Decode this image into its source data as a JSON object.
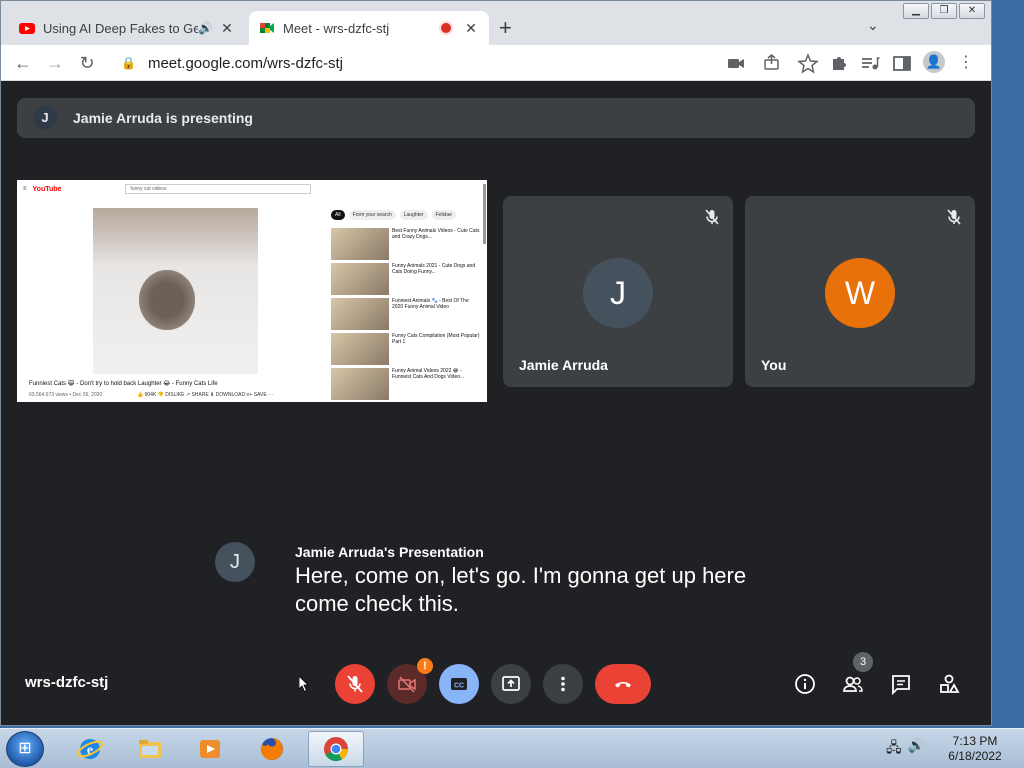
{
  "browser": {
    "tabs": [
      {
        "title": "Using AI Deep Fakes to Get R",
        "state": "inactive",
        "favicon": "youtube-icon"
      },
      {
        "title": "Meet - wrs-dzfc-stj",
        "state": "active",
        "favicon": "google-meet-icon"
      }
    ],
    "url": "meet.google.com/wrs-dzfc-stj"
  },
  "meet": {
    "presenting_banner": {
      "avatar_letter": "J",
      "text": "Jamie Arruda is presenting"
    },
    "presentation": {
      "yt_logo": "YouTube",
      "search": "funny cat videos",
      "chips": [
        "All",
        "From your search",
        "Laughter",
        "Felidae"
      ],
      "video_title": "Funniest Cats 😹 - Don't try to hold back Laughter 😂 - Funny Cats Life",
      "video_meta": "63,564,673 views • Dec 26, 2020",
      "video_actions": "👍 904K   👎 DISLIKE   ↗ SHARE   ⬇ DOWNLOAD   ≡+ SAVE   ···",
      "related": [
        {
          "title": "Best Funny Animals Videos - Cute Cats and Crazy Dogs..."
        },
        {
          "title": "Funny Animals 2021 - Cute Dogs and Cats Doing Funny..."
        },
        {
          "title": "Funniest Animals 🐾 - Best Of The 2020 Funny Animal Video"
        },
        {
          "title": "Funny Cats Compilation (Most Popular) Part 1"
        },
        {
          "title": "Funny Animal Videos 2022 😂 - Funniest Cats And Dogs Video..."
        }
      ]
    },
    "participants": [
      {
        "name": "Jamie Arruda",
        "initial": "J",
        "avatar_color": "#46515e",
        "muted": true
      },
      {
        "name": "You",
        "initial": "W",
        "avatar_color": "#e8710a",
        "muted": true
      }
    ],
    "caption": {
      "avatar_letter": "J",
      "speaker": "Jamie Arruda's Presentation",
      "text": "Here, come on, let's go. I'm gonna get up here come check this."
    },
    "meeting_code": "wrs-dzfc-stj",
    "people_count": "3",
    "warning_badge": "!"
  },
  "taskbar": {
    "time": "7:13 PM",
    "date": "6/18/2022"
  },
  "colors": {
    "meet_bg": "#202124",
    "tile_bg": "#3c4043",
    "mic_off": "#ea4335",
    "cc_on": "#8ab4f8",
    "hangup": "#ea4335"
  }
}
